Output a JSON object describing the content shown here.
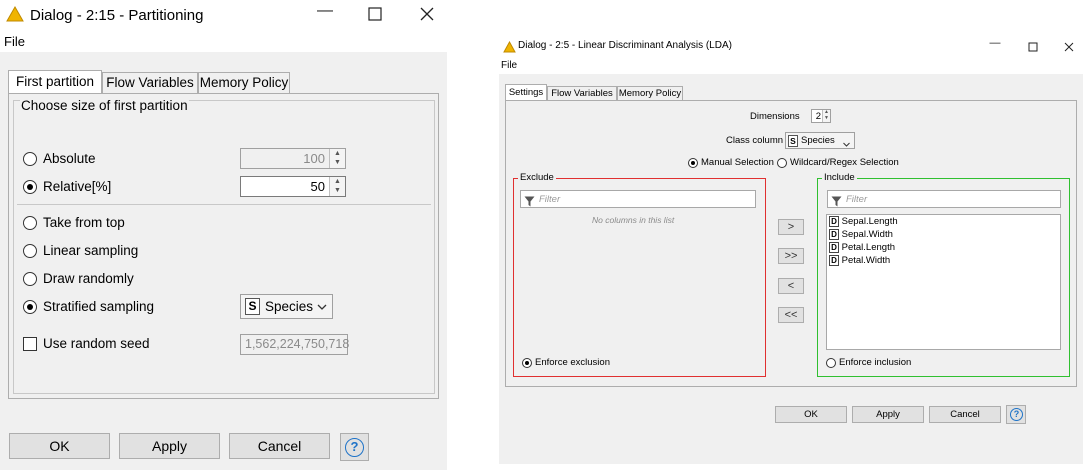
{
  "left_dialog": {
    "title": "Dialog - 2:15 - Partitioning",
    "menu": "File",
    "tabs": [
      "First partition",
      "Flow Variables",
      "Memory Policy"
    ],
    "group_title": "Choose size of first partition",
    "absolute": {
      "label": "Absolute",
      "value": "100",
      "selected": false
    },
    "relative": {
      "label": "Relative[%]",
      "value": "50",
      "selected": true
    },
    "options": [
      {
        "label": "Take from top",
        "selected": false
      },
      {
        "label": "Linear sampling",
        "selected": false
      },
      {
        "label": "Draw randomly",
        "selected": false
      },
      {
        "label": "Stratified sampling",
        "selected": true
      }
    ],
    "class_column": {
      "type": "S",
      "value": "Species"
    },
    "random_seed": {
      "label": "Use random seed",
      "checked": false,
      "value": "1,562,224,750,718"
    },
    "buttons": {
      "ok": "OK",
      "apply": "Apply",
      "cancel": "Cancel",
      "help": "?"
    }
  },
  "right_dialog": {
    "title": "Dialog - 2:5 - Linear Discriminant Analysis (LDA)",
    "menu": "File",
    "tabs": [
      "Settings",
      "Flow Variables",
      "Memory Policy"
    ],
    "dimensions": {
      "label": "Dimensions",
      "value": "2"
    },
    "class_column": {
      "label": "Class column",
      "type": "S",
      "value": "Species"
    },
    "selection_modes": [
      {
        "label": "Manual Selection",
        "selected": true
      },
      {
        "label": "Wildcard/Regex Selection",
        "selected": false
      }
    ],
    "exclude": {
      "title": "Exclude",
      "filter_placeholder": "Filter",
      "empty_text": "No columns in this list",
      "enforce_label": "Enforce exclusion",
      "enforce_selected": true,
      "color": "#e03030"
    },
    "include": {
      "title": "Include",
      "filter_placeholder": "Filter",
      "columns": [
        {
          "type": "D",
          "name": "Sepal.Length"
        },
        {
          "type": "D",
          "name": "Sepal.Width"
        },
        {
          "type": "D",
          "name": "Petal.Length"
        },
        {
          "type": "D",
          "name": "Petal.Width"
        }
      ],
      "enforce_label": "Enforce inclusion",
      "enforce_selected": false,
      "color": "#30c030"
    },
    "move_buttons": [
      ">",
      ">>",
      "<",
      "<<"
    ],
    "buttons": {
      "ok": "OK",
      "apply": "Apply",
      "cancel": "Cancel",
      "help": "?"
    }
  },
  "colors": {
    "knime_warning": "#f0b400",
    "help_blue": "#1e73c8"
  }
}
